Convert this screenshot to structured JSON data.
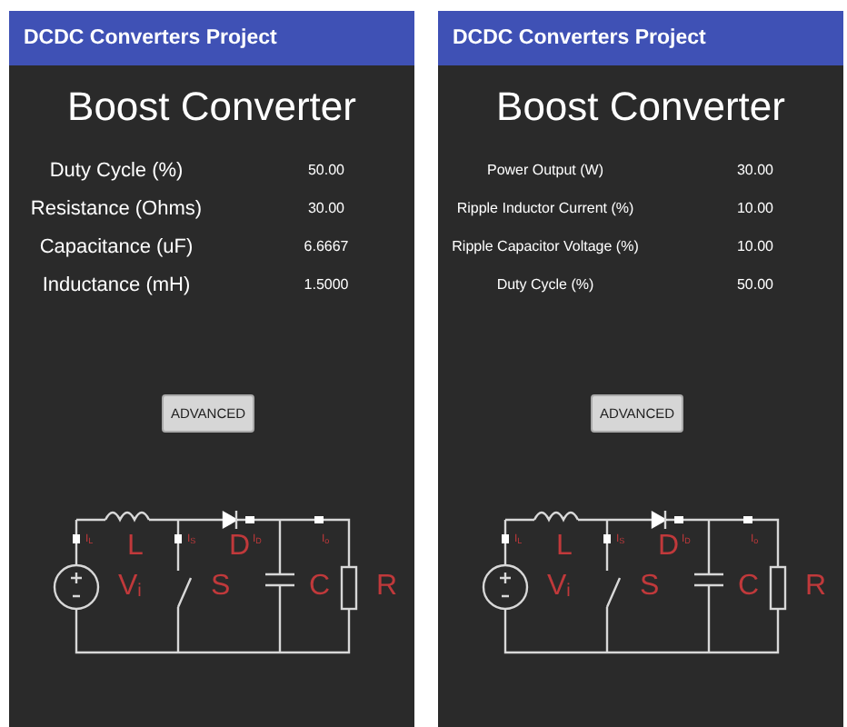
{
  "screens": [
    {
      "app_bar": {
        "title": "DCDC Converters Project"
      },
      "title": "Boost Converter",
      "parameters": [
        {
          "label": "Duty Cycle (%)",
          "value": "50.00"
        },
        {
          "label": "Resistance (Ohms)",
          "value": "30.00"
        },
        {
          "label": "Capacitance (uF)",
          "value": "6.6667"
        },
        {
          "label": "Inductance (mH)",
          "value": "1.5000"
        }
      ],
      "button": "ADVANCED",
      "circuit": {
        "components": [
          {
            "letter": "L"
          },
          {
            "letter": "D"
          },
          {
            "letter": "V",
            "sub": "i"
          },
          {
            "letter": "S"
          },
          {
            "letter": "C"
          },
          {
            "letter": "R"
          }
        ],
        "currents": [
          {
            "letter": "I",
            "sub": "L"
          },
          {
            "letter": "I",
            "sub": "S"
          },
          {
            "letter": "I",
            "sub": "D"
          },
          {
            "letter": "I",
            "sub": "o"
          }
        ]
      }
    },
    {
      "app_bar": {
        "title": "DCDC Converters Project"
      },
      "title": "Boost Converter",
      "parameters": [
        {
          "label": "Power Output (W)",
          "value": "30.00"
        },
        {
          "label": "Ripple Inductor Current (%)",
          "value": "10.00"
        },
        {
          "label": "Ripple Capacitor Voltage (%)",
          "value": "10.00"
        },
        {
          "label": "Duty Cycle (%)",
          "value": "50.00"
        }
      ],
      "button": "ADVANCED",
      "circuit": {
        "components": [
          {
            "letter": "L"
          },
          {
            "letter": "D"
          },
          {
            "letter": "V",
            "sub": "i"
          },
          {
            "letter": "S"
          },
          {
            "letter": "C"
          },
          {
            "letter": "R"
          }
        ],
        "currents": [
          {
            "letter": "I",
            "sub": "L"
          },
          {
            "letter": "I",
            "sub": "S"
          },
          {
            "letter": "I",
            "sub": "D"
          },
          {
            "letter": "I",
            "sub": "o"
          }
        ]
      }
    }
  ]
}
